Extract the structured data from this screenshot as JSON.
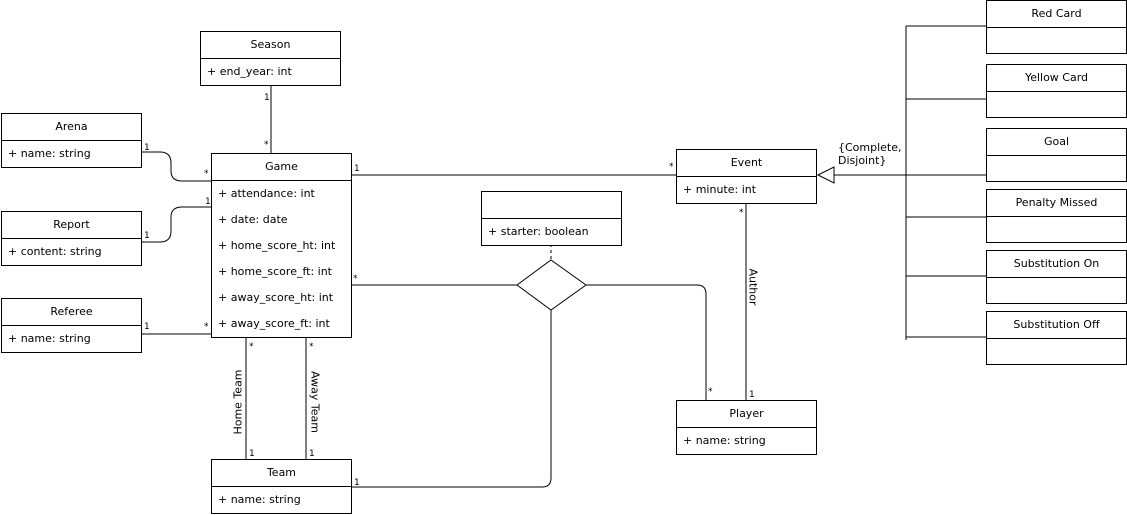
{
  "classes": {
    "season": {
      "name": "Season",
      "attrs": [
        "+ end_year: int"
      ]
    },
    "arena": {
      "name": "Arena",
      "attrs": [
        "+ name: string"
      ]
    },
    "report": {
      "name": "Report",
      "attrs": [
        "+ content: string"
      ]
    },
    "referee": {
      "name": "Referee",
      "attrs": [
        "+ name: string"
      ]
    },
    "game": {
      "name": "Game",
      "attrs": [
        "+ attendance: int",
        "+ date: date",
        "+ home_score_ht: int",
        "+ home_score_ft: int",
        "+ away_score_ht: int",
        "+ away_score_ft: int"
      ]
    },
    "team": {
      "name": "Team",
      "attrs": [
        "+ name: string"
      ]
    },
    "association": {
      "name": "",
      "attrs": [
        "+ starter: boolean"
      ]
    },
    "event": {
      "name": "Event",
      "attrs": [
        "+ minute: int"
      ]
    },
    "player": {
      "name": "Player",
      "attrs": [
        "+ name: string"
      ]
    },
    "red_card": {
      "name": "Red Card"
    },
    "yellow_card": {
      "name": "Yellow Card"
    },
    "goal": {
      "name": "Goal"
    },
    "penalty_missed": {
      "name": "Penalty Missed"
    },
    "substitution_on": {
      "name": "Substitution On"
    },
    "substitution_off": {
      "name": "Substitution Off"
    }
  },
  "multiplicities": {
    "season_game_season": "1",
    "season_game_game": "*",
    "arena_game_arena": "1",
    "arena_game_game": "*",
    "report_game_report": "1",
    "report_game_game": "1",
    "referee_game_referee": "1",
    "referee_game_game": "*",
    "game_event_game": "1",
    "game_event_event": "*",
    "game_assoc_game": "*",
    "assoc_player": "*",
    "assoc_team": "1",
    "event_player_event": "*",
    "event_player_player": "1",
    "home_game": "*",
    "home_team": "1",
    "away_game": "*",
    "away_team": "1"
  },
  "roles": {
    "home": "Home Team",
    "away": "Away Team",
    "author": "Author"
  },
  "generalization": {
    "line1": "{Complete,",
    "line2": "Disjoint}"
  }
}
